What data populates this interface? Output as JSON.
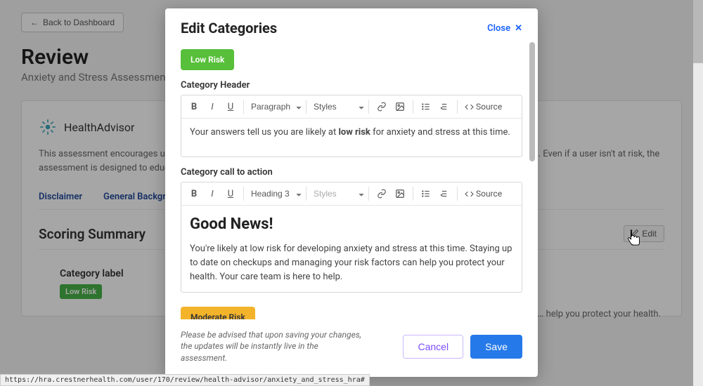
{
  "page": {
    "back": "Back to Dashboard",
    "title": "Review",
    "subtitle": "Anxiety and Stress Assessment",
    "brand": "HealthAdvisor",
    "desc": "This assessment encourages users with heightened stress and anxiety levels to seek further evaluation from their providers. Even if a user isn't at risk, the assessment is designed to educate…",
    "tabs": {
      "disclaimer": "Disclaimer",
      "background": "General Background"
    },
    "scoring_title": "Scoring Summary",
    "edit": "Edit",
    "cat_label_title": "Category label",
    "cat_badge": "Low Risk",
    "trail": "…ess at this time. Staying up to … help you protect your health."
  },
  "modal": {
    "title": "Edit Categories",
    "close": "Close",
    "pill_low": "Low Risk",
    "pill_mod": "Moderate Risk",
    "header_label": "Category Header",
    "cta_label": "Category call to action",
    "toolbar": {
      "bold": "B",
      "italic": "I",
      "underline": "U",
      "paragraph": "Paragraph",
      "heading3": "Heading 3",
      "styles": "Styles",
      "source": "Source"
    },
    "header_content": {
      "pre": "Your answers tell us you are likely at ",
      "bold": "low risk",
      "post": " for anxiety and stress at this time."
    },
    "cta_content": {
      "heading": "Good News!",
      "body": "You're likely at low risk for developing anxiety and stress at this time. Staying up to date on checkups and managing your risk factors can help you protect your health. Your care team is here to help."
    },
    "note": "Please be advised that upon saving your changes, the updates will be instantly live in the assessment.",
    "cancel": "Cancel",
    "save": "Save"
  },
  "status_url": "https://hra.crestnerhealth.com/user/170/review/health-advisor/anxiety_and_stress_hra#"
}
